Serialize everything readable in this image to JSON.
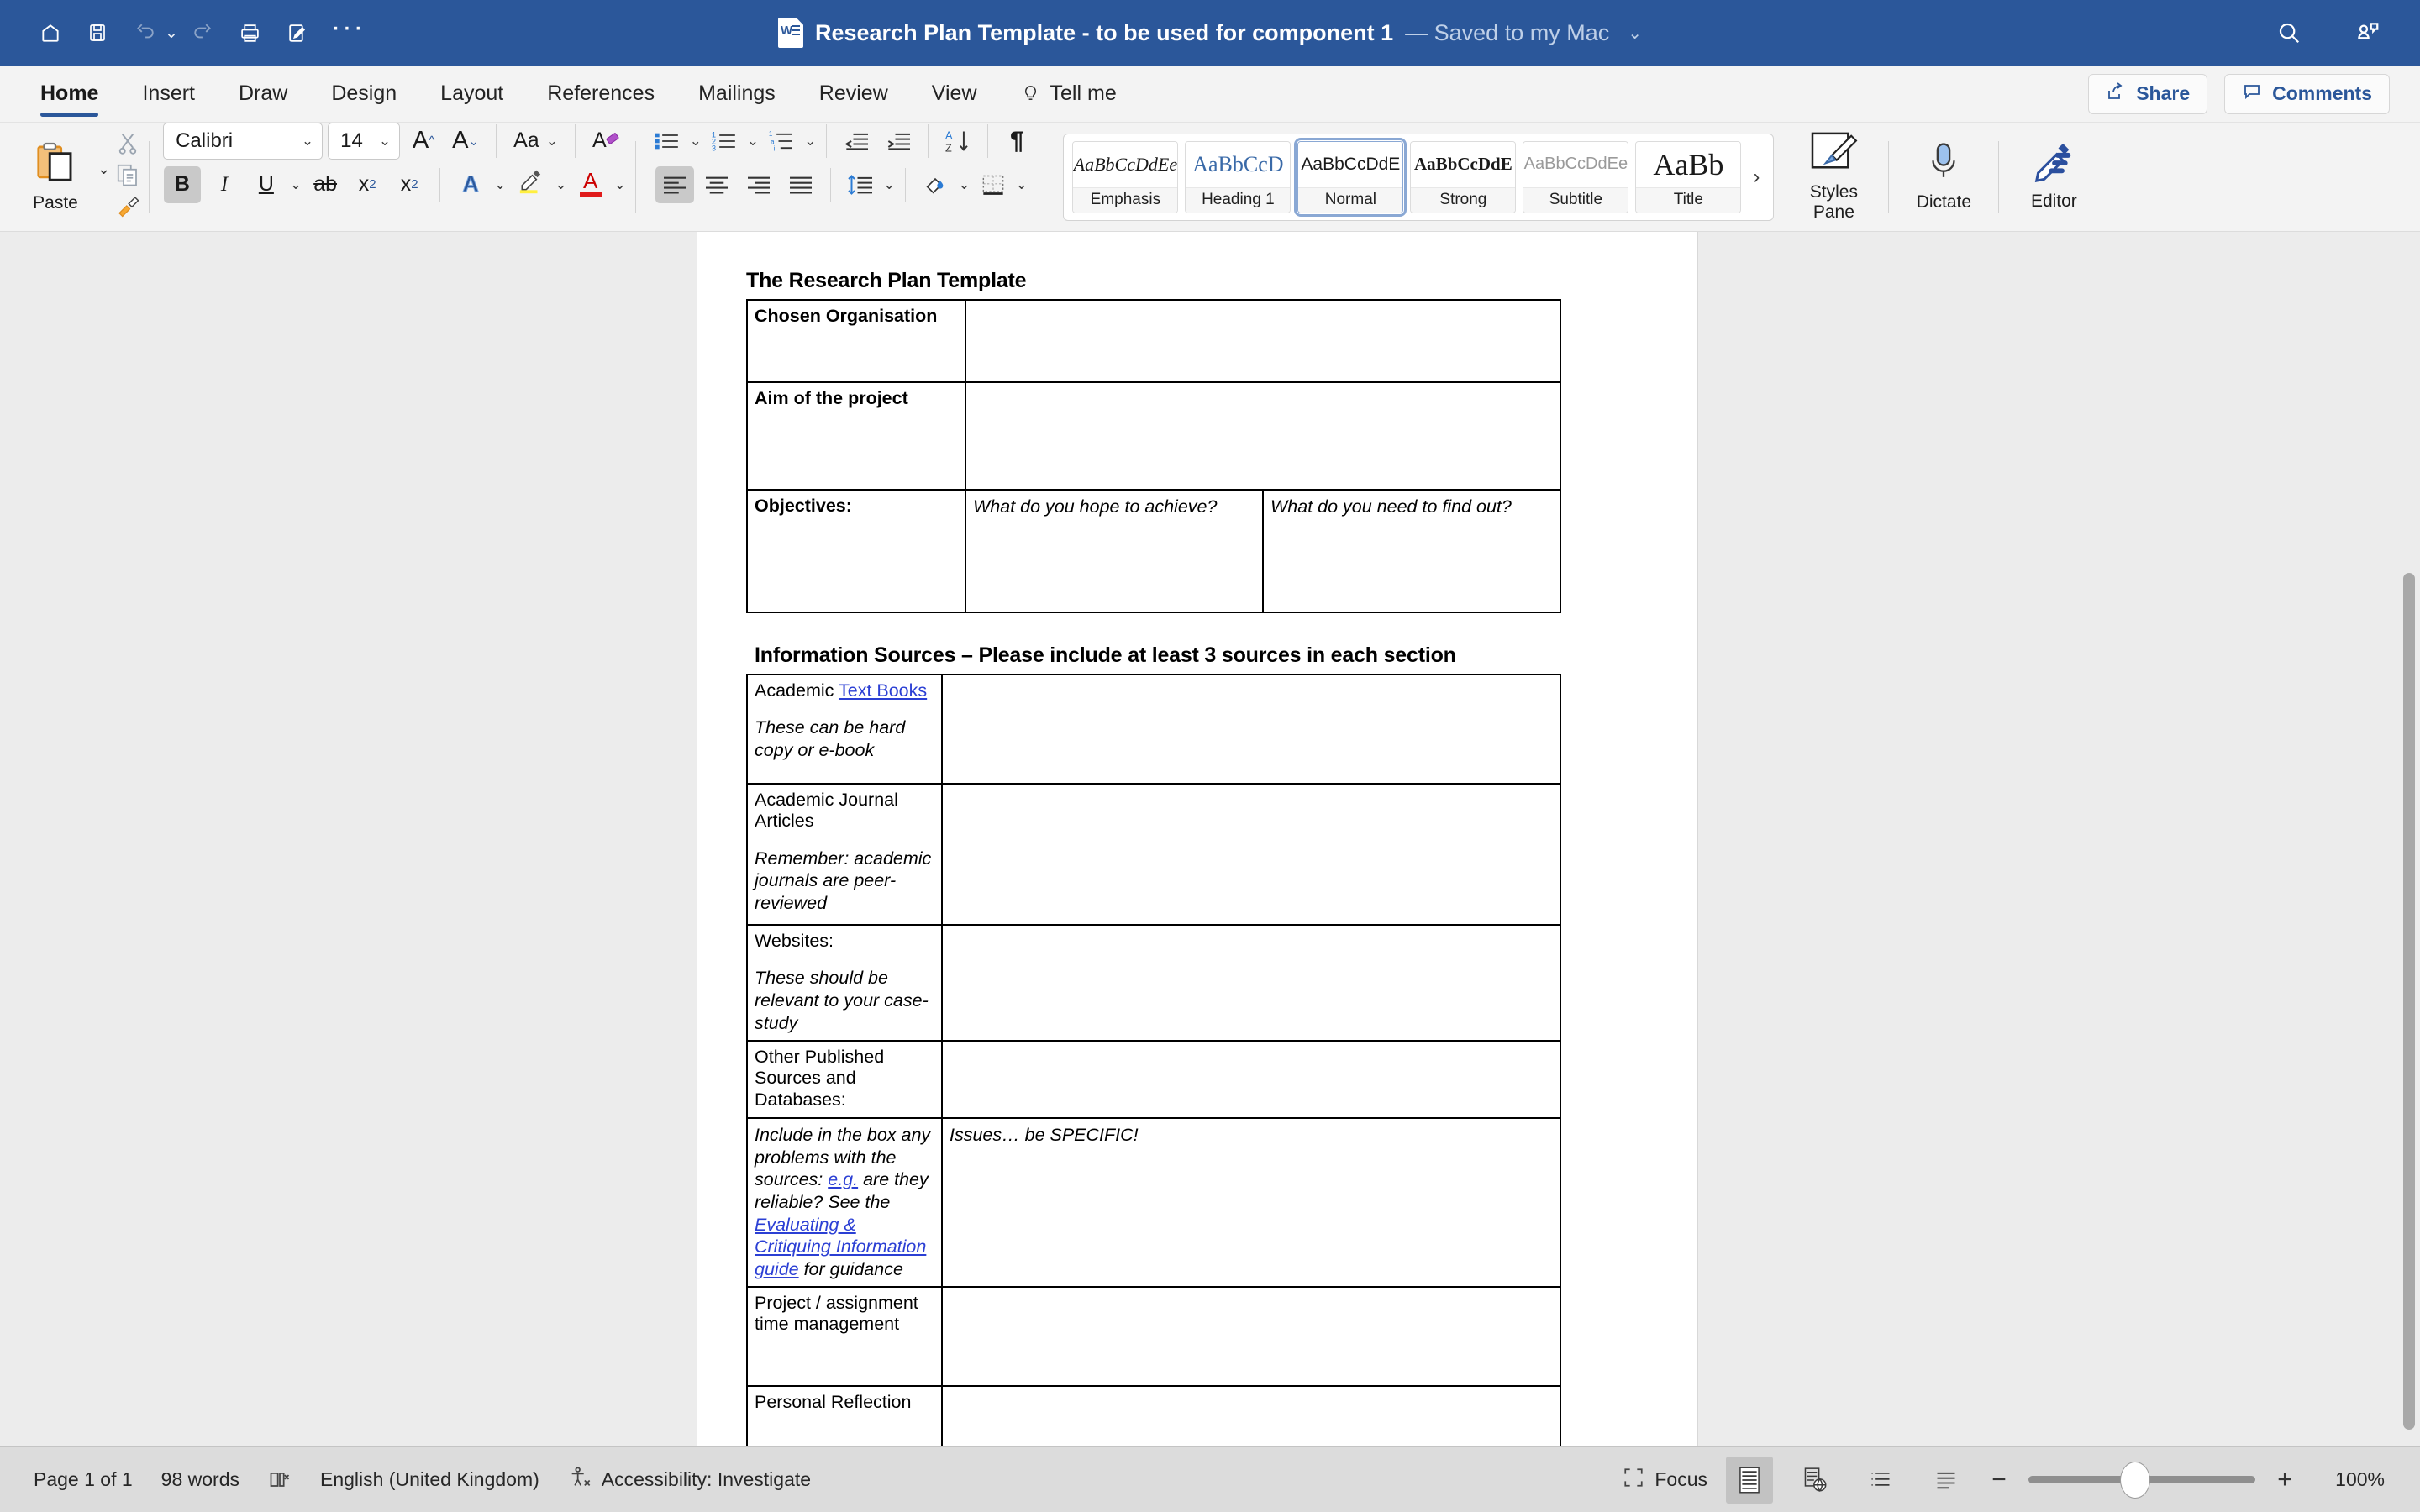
{
  "titlebar": {
    "icons": [
      "home-icon",
      "save-icon",
      "undo-icon",
      "redo-icon",
      "print-icon",
      "quick-print-icon",
      "more-icon"
    ],
    "doc_title": "Research Plan Template - to be used for component 1",
    "save_state": "— Saved to my Mac",
    "search_icon": "search-icon",
    "collab_icon": "collaborators-icon"
  },
  "tabs": [
    {
      "label": "Home",
      "active": true
    },
    {
      "label": "Insert",
      "active": false
    },
    {
      "label": "Draw",
      "active": false
    },
    {
      "label": "Design",
      "active": false
    },
    {
      "label": "Layout",
      "active": false
    },
    {
      "label": "References",
      "active": false
    },
    {
      "label": "Mailings",
      "active": false
    },
    {
      "label": "Review",
      "active": false
    },
    {
      "label": "View",
      "active": false
    },
    {
      "label": "Tell me",
      "active": false,
      "icon": "lightbulb-icon"
    }
  ],
  "tabbar_right": {
    "share_label": "Share",
    "comments_label": "Comments"
  },
  "ribbon": {
    "paste_label": "Paste",
    "font_name": "Calibri",
    "font_size": "14",
    "grow_font": "A",
    "shrink_font": "A",
    "change_case": "Aa",
    "clear_formatting": "A",
    "bold": "B",
    "italic": "I",
    "underline": "U",
    "strikethrough": "ab",
    "subscript": "x",
    "subscript_n": "2",
    "superscript": "x",
    "superscript_n": "2",
    "text_effects": "A",
    "highlight": "highlight-icon",
    "font_color": "A",
    "styles": [
      {
        "preview": "AaBbCcDdEe",
        "name": "Emphasis",
        "selected": false,
        "kind": "emphasis"
      },
      {
        "preview": "AaBbCcD",
        "name": "Heading 1",
        "selected": false,
        "kind": "heading1"
      },
      {
        "preview": "AaBbCcDdE",
        "name": "Normal",
        "selected": true,
        "kind": "normal"
      },
      {
        "preview": "AaBbCcDdE",
        "name": "Strong",
        "selected": false,
        "kind": "strong"
      },
      {
        "preview": "AaBbCcDdEe",
        "name": "Subtitle",
        "selected": false,
        "kind": "subtitle"
      },
      {
        "preview": "AaBb",
        "name": "Title",
        "selected": false,
        "kind": "title"
      }
    ],
    "styles_pane_label": "Styles\nPane",
    "styles_pane_line1": "Styles",
    "styles_pane_line2": "Pane",
    "dictate_label": "Dictate",
    "editor_label": "Editor"
  },
  "document": {
    "heading1": "The Research Plan Template",
    "table1": [
      {
        "label": "Chosen Organisation",
        "bold": true,
        "cols": 1
      },
      {
        "label": "Aim of the project",
        "bold": true,
        "cols": 1
      },
      {
        "label": "Objectives:",
        "bold": true,
        "cols": 2,
        "col2": "What do you hope to achieve?",
        "col3": "What do you need to find out?"
      }
    ],
    "heading2": "Information Sources – Please include at least 3 sources in each section",
    "table2": [
      {
        "label": "Academic ",
        "link": "Text Books",
        "note": "These can be hard copy or e-book",
        "value": ""
      },
      {
        "label": "Academic Journal Articles",
        "note": "Remember: academic journals are peer-reviewed",
        "value": ""
      },
      {
        "label": "Websites:",
        "note": "These should be relevant to your case-study",
        "value": ""
      },
      {
        "label": "Other Published Sources and Databases:",
        "note": "",
        "value": ""
      },
      {
        "label_italic_1": "Include in the box any problems with the sources: ",
        "label_link_1": "e.g.",
        "label_italic_2": " are they reliable? See the ",
        "label_link_2": "Evaluating & Critiquing Information guide",
        "label_italic_3": " for guidance",
        "value": "Issues… be SPECIFIC!"
      },
      {
        "label": "Project / assignment time management",
        "note": "",
        "value": ""
      },
      {
        "label": "Personal Reflection",
        "note": "",
        "value": ""
      }
    ]
  },
  "statusbar": {
    "page_count": "Page 1 of 1",
    "word_count": "98 words",
    "proofing_icon": "proofing-errors-icon",
    "language": "English (United Kingdom)",
    "accessibility": "Accessibility: Investigate",
    "focus_label": "Focus",
    "views": [
      "print-layout-view",
      "web-layout-view",
      "outline-view",
      "draft-view"
    ],
    "zoom_minus": "−",
    "zoom_plus": "+",
    "zoom_level": "100%"
  },
  "colors": {
    "title_bar": "#2b579a",
    "accent": "#2b579a",
    "ribbon_bg": "#f3f3f3",
    "doc_bg": "#ececec",
    "status_bg": "#dcdcdc",
    "link": "#2b3fd4"
  }
}
